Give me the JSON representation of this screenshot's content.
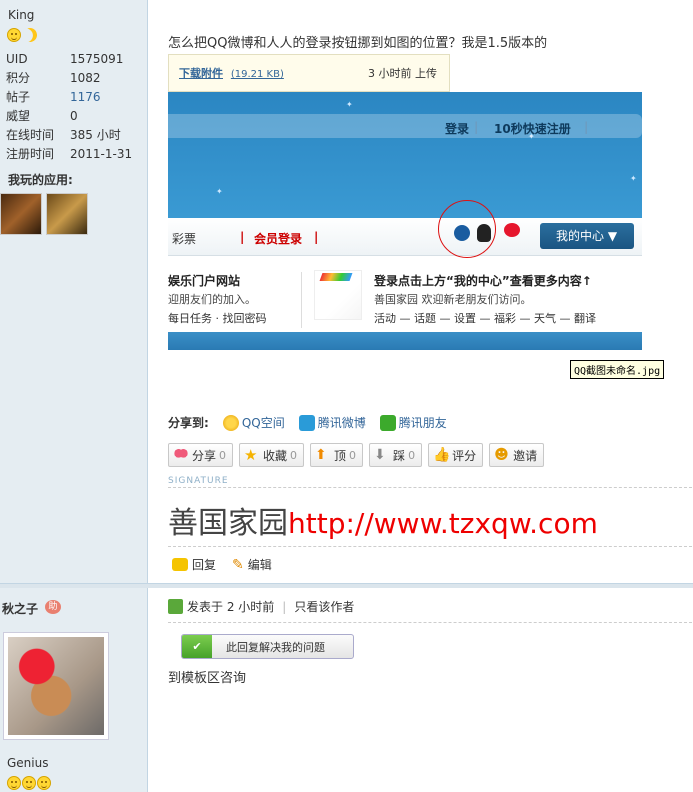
{
  "post1": {
    "author": {
      "name": "King",
      "stats": [
        {
          "label": "UID",
          "value": "1575091"
        },
        {
          "label": "积分",
          "value": "1082"
        },
        {
          "label": "帖子",
          "value": "1176"
        },
        {
          "label": "威望",
          "value": "0"
        },
        {
          "label": "在线时间",
          "value": "385 小时"
        },
        {
          "label": "注册时间",
          "value": "2011-1-31"
        }
      ],
      "apps_title": "我玩的应用:"
    },
    "title": "怎么把QQ微博和人人的登录按钮挪到如图的位置？我是1.5版本的",
    "attachment": {
      "link": "下载附件",
      "size": "(19.21 KB)",
      "time": "3 小时前 上传"
    },
    "screenshot": {
      "login": "登录",
      "quick_register": "10秒快速注册",
      "menu_lottery": "彩票",
      "menu_member_login": "会员登录",
      "my_center": "我的中心 ▼",
      "left_title": "娱乐门户网站",
      "left_text": "迎朋友们的加入。",
      "left_links": "每日任务 · 找回密码",
      "right_title": "登录点击上方“我的中心”查看更多内容↑",
      "right_text": "善国家园 欢迎新老朋友们访问。",
      "right_links": "活动 — 话题 — 设置 — 福彩 — 天气 — 翻译",
      "caption": "QQ截图未命名.jpg"
    },
    "share": {
      "label": "分享到:",
      "items": [
        "QQ空间",
        "腾讯微博",
        "腾讯朋友"
      ]
    },
    "actions": [
      {
        "label": "分享",
        "count": "0"
      },
      {
        "label": "收藏",
        "count": "0"
      },
      {
        "label": "顶",
        "count": "0"
      },
      {
        "label": "踩",
        "count": "0"
      },
      {
        "label": "评分",
        "count": ""
      },
      {
        "label": "邀请",
        "count": ""
      }
    ],
    "signature_label": "SIGNATURE",
    "signature": {
      "cn": "善国家园",
      "url": "http://www.tzxqw.com"
    },
    "reply_label": "回复",
    "edit_label": "编辑"
  },
  "post2": {
    "author": {
      "name": "秋之子",
      "badge": "助",
      "rank": "Genius"
    },
    "posted_label": "发表于 2 小时前",
    "only_author": "只看该作者",
    "solve_label": "此回复解决我的问题",
    "text": "到模板区咨询"
  },
  "icons": [
    "smile-icon",
    "moon-icon",
    "qzone-icon",
    "tencent-weibo-icon",
    "tencent-friends-icon",
    "heart-icon",
    "star-icon",
    "up-arrow-icon",
    "down-arrow-icon",
    "thumb-icon",
    "invite-icon",
    "reply-icon",
    "edit-icon",
    "user-icon",
    "check-icon"
  ]
}
